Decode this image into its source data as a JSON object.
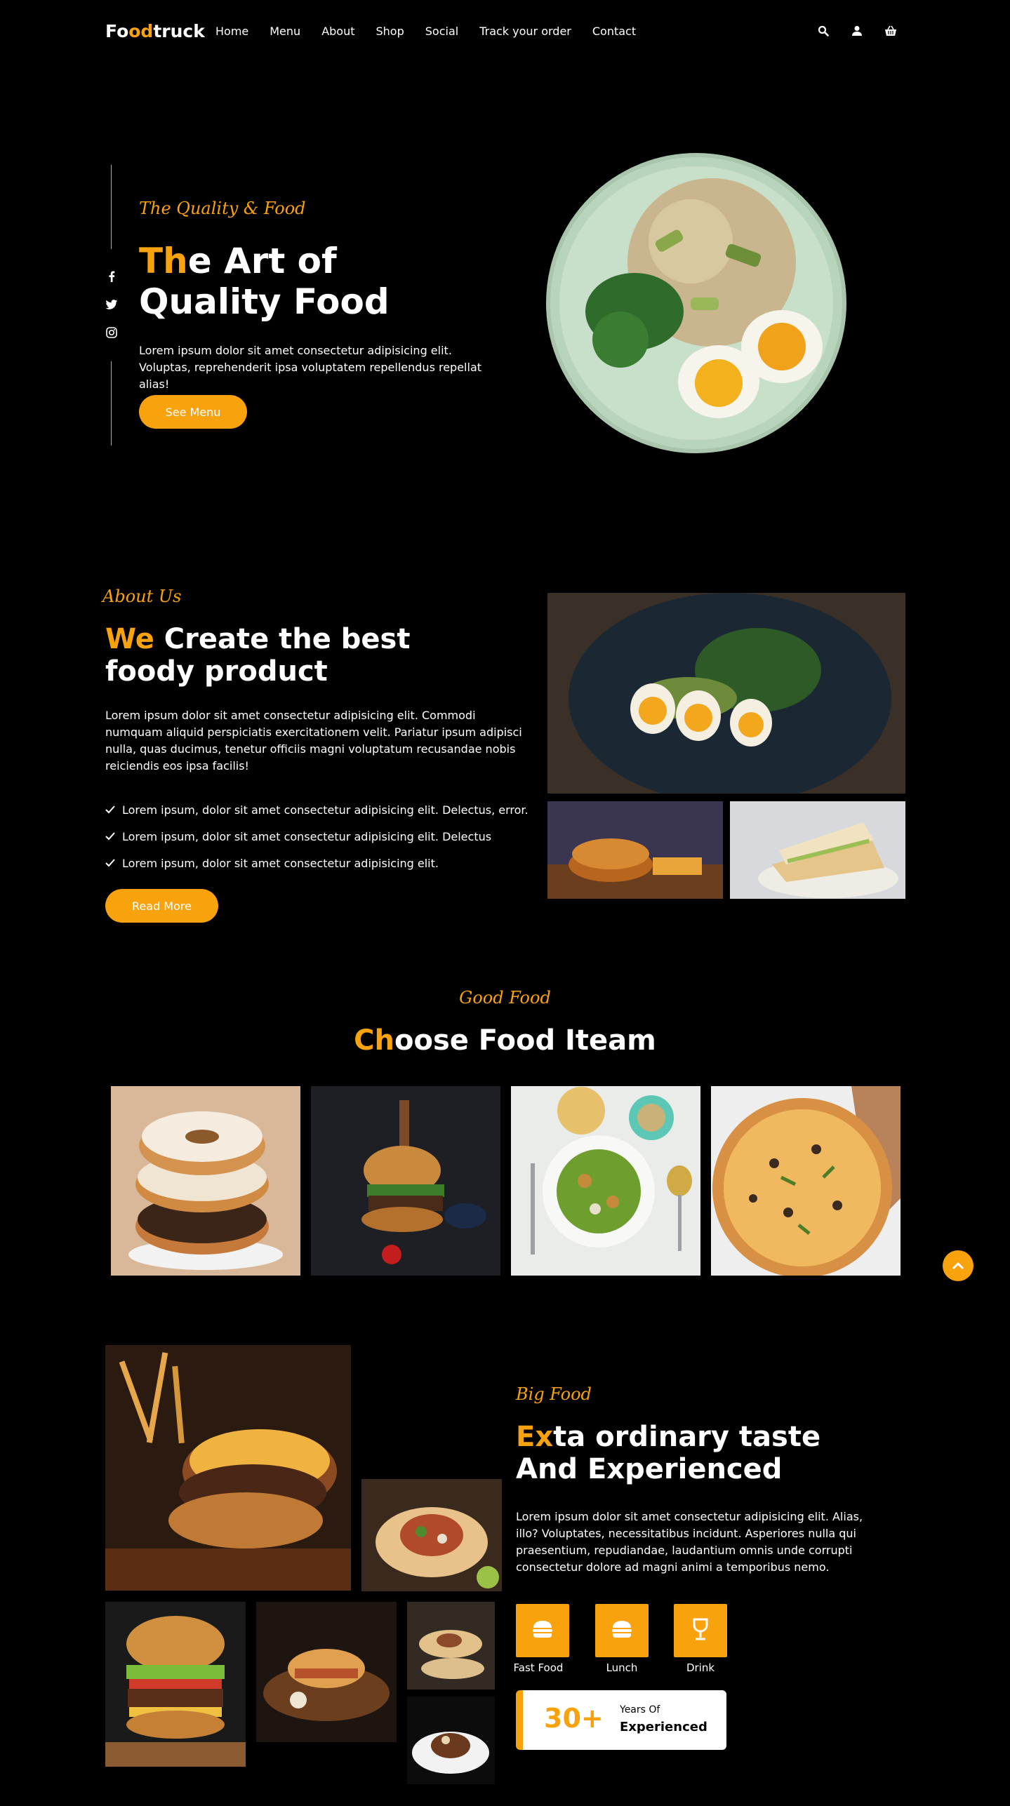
{
  "brand": {
    "first": "Fo",
    "accent": "od",
    "rest": "truck"
  },
  "nav": {
    "items": [
      "Home",
      "Menu",
      "About",
      "Shop",
      "Social",
      "Track your order",
      "Contact"
    ]
  },
  "nav_icons": [
    "search-icon",
    "user-icon",
    "basket-icon"
  ],
  "hero": {
    "tagline": "The Quality & Food",
    "title_accent": "Th",
    "title_rest1": "e Art of",
    "title_line2": "Quality Food",
    "text": "Lorem ipsum dolor sit amet consectetur adipisicing elit. Voluptas, reprehenderit ipsa voluptatem repellendus repellat alias!",
    "button": "See Menu",
    "social_icons": [
      "facebook-icon",
      "twitter-icon",
      "instagram-icon"
    ]
  },
  "about": {
    "tagline": "About Us",
    "title_accent": "We",
    "title_rest1": " Create the best",
    "title_line2": "foody product",
    "text": "Lorem ipsum dolor sit amet consectetur adipisicing elit. Commodi numquam aliquid perspiciatis exercitationem velit. Pariatur ipsum adipisci nulla, quas ducimus, tenetur officiis magni voluptatum recusandae nobis reiciendis eos ipsa facilis!",
    "checks": [
      "Lorem ipsum, dolor sit amet consectetur adipisicing elit. Delectus, error.",
      "Lorem ipsum, dolor sit amet consectetur adipisicing elit. Delectus",
      "Lorem ipsum, dolor sit amet consectetur adipisicing elit."
    ],
    "button": "Read More"
  },
  "choose": {
    "tagline": "Good Food",
    "title_accent": "Ch",
    "title_rest": "oose Food Iteam"
  },
  "big": {
    "tagline": "Big Food",
    "title_accent": "Ex",
    "title_rest1": "ta ordinary taste",
    "title_line2": "And Experienced",
    "text": "Lorem ipsum dolor sit amet consectetur adipisicing elit. Alias, illo? Voluptates, necessitatibus incidunt. Asperiores nulla qui praesentium, repudiandae, laudantium omnis unde corrupti consectetur dolore ad magni animi a temporibus nemo.",
    "categories": [
      {
        "label": "Fast Food",
        "icon": "burger-icon"
      },
      {
        "label": "Lunch",
        "icon": "burger-icon"
      },
      {
        "label": "Drink",
        "icon": "wine-glass-icon"
      }
    ],
    "exp_number": "30+",
    "exp_line1": "Years Of",
    "exp_line2": "Experienced"
  },
  "colors": {
    "accent": "#f8a20e",
    "background": "#000000"
  }
}
